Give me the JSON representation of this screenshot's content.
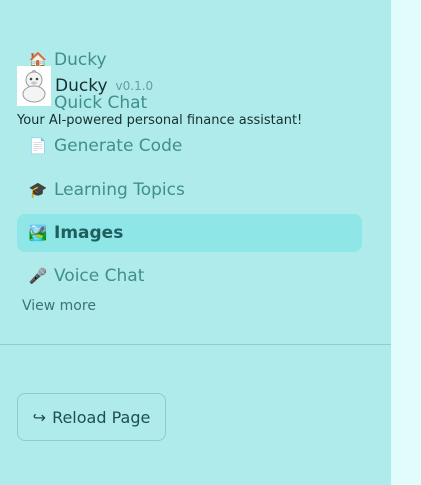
{
  "app": {
    "name": "Ducky",
    "version": "v0.1.0",
    "tagline": "Your AI-powered personal finance assistant!"
  },
  "nav": [
    {
      "id": "ducky",
      "icon": "🏠",
      "label": "Ducky"
    },
    {
      "id": "quick-chat",
      "icon": "",
      "label": "Quick Chat"
    },
    {
      "id": "generate-code",
      "icon": "📄",
      "label": "Generate Code"
    },
    {
      "id": "learning-topics",
      "icon": "🎓",
      "label": "Learning Topics"
    },
    {
      "id": "images",
      "icon": "🏞️",
      "label": "Images",
      "active": true
    },
    {
      "id": "voice-chat",
      "icon": "🎤",
      "label": "Voice Chat"
    }
  ],
  "view_more": "View more",
  "reload": {
    "icon": "↪",
    "label": "Reload Page"
  },
  "colors": {
    "sidebar": "#b0ebeb",
    "active": "#8fe6e6",
    "main": "#e0fcfc"
  }
}
